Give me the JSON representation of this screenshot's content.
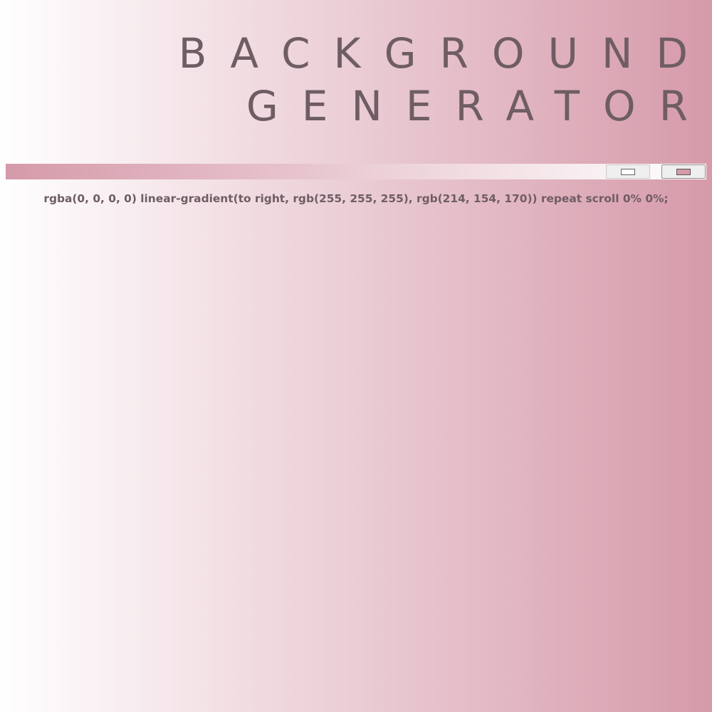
{
  "header": {
    "title_line1": "BACKGROUND",
    "title_line2": "GENERATOR"
  },
  "controls": {
    "color1": {
      "value": "#ffffff",
      "label": "color picker 1"
    },
    "color2": {
      "value": "#d69aaa",
      "label": "color picker 2"
    }
  },
  "output": {
    "css_text": "rgba(0, 0, 0, 0) linear-gradient(to right, rgb(255, 255, 255), rgb(214, 154, 170)) repeat scroll 0% 0%;"
  },
  "colors": {
    "text": "#6f5d64",
    "gradient_start": "#ffffff",
    "gradient_end": "#d69aaa"
  }
}
